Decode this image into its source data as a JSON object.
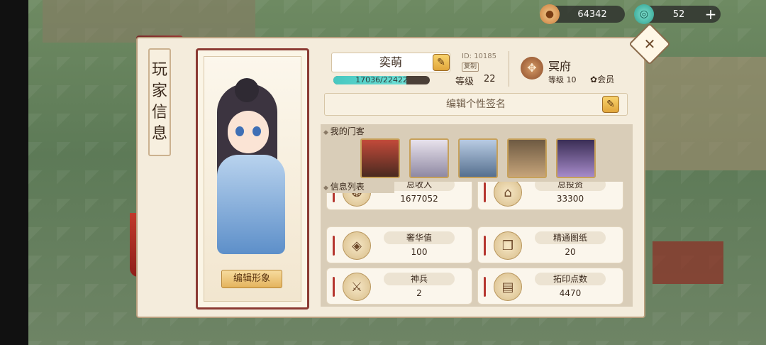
{
  "resources": {
    "coins": "64342",
    "jade": "52"
  },
  "side_title": [
    "玩",
    "家",
    "信",
    "息"
  ],
  "portrait": {
    "edit_button": "编辑形象"
  },
  "player": {
    "name": "奕萌",
    "id_label": "ID: 10185",
    "copy_label": "复制",
    "exp_text": "17036/22422",
    "exp_fraction": 0.76,
    "level_label": "等级",
    "level_value": "22"
  },
  "mansion": {
    "name": "冥府",
    "level": "等级 10",
    "member": "会员"
  },
  "signature": {
    "placeholder": "编辑个性签名"
  },
  "guests": {
    "header": "我的门客",
    "portraits": [
      "guest-1",
      "guest-2",
      "guest-3",
      "guest-4",
      "guest-5"
    ]
  },
  "info": {
    "header": "信息列表",
    "items": [
      {
        "label": "总收入",
        "value": "1677052",
        "icon": "coin-bag-icon"
      },
      {
        "label": "总投资",
        "value": "33300",
        "icon": "building-icon"
      },
      {
        "label": "奢华值",
        "value": "100",
        "icon": "treasure-icon"
      },
      {
        "label": "精通图纸",
        "value": "20",
        "icon": "scroll-icon"
      },
      {
        "label": "神兵",
        "value": "2",
        "icon": "weapon-icon"
      },
      {
        "label": "拓印点数",
        "value": "4470",
        "icon": "book-icon"
      }
    ]
  },
  "colors": {
    "banner": "#8e3431",
    "exp_fill": "#5fd6cc",
    "accent_gold": "#e4b35d"
  }
}
